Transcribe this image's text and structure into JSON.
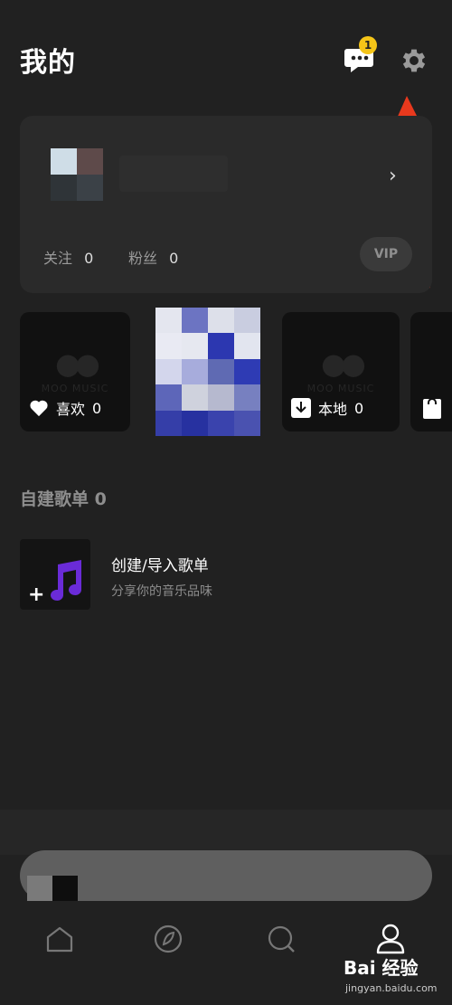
{
  "header": {
    "title": "我的",
    "message_badge": "1"
  },
  "profile": {
    "follow_label": "关注",
    "follow_count": "0",
    "fans_label": "粉丝",
    "fans_count": "0",
    "vip_label": "VIP",
    "chevron": "›"
  },
  "tiles": [
    {
      "label": "喜欢",
      "count": "0",
      "icon": "heart-icon"
    },
    {
      "label": "本地",
      "count": "0",
      "icon": "download-icon"
    },
    {
      "icon": "bag-icon"
    }
  ],
  "tile_watermark": "MOO MUSIC",
  "playlists": {
    "section_title": "自建歌单 0",
    "create_title": "创建/导入歌单",
    "create_subtitle": "分享你的音乐品味",
    "icon": "music-note-icon"
  },
  "tabbar": [
    {
      "icon": "home-icon"
    },
    {
      "icon": "discover-icon"
    },
    {
      "icon": "search-icon"
    },
    {
      "icon": "profile-icon"
    }
  ],
  "watermark": {
    "logo": "Bai 经验",
    "url": "jingyan.baidu.com"
  },
  "colors": {
    "background": "#212121",
    "card": "#2a2a2a",
    "badge": "#f5c518",
    "arrow": "#e8391d",
    "music_icon": "#6a2bd8"
  }
}
